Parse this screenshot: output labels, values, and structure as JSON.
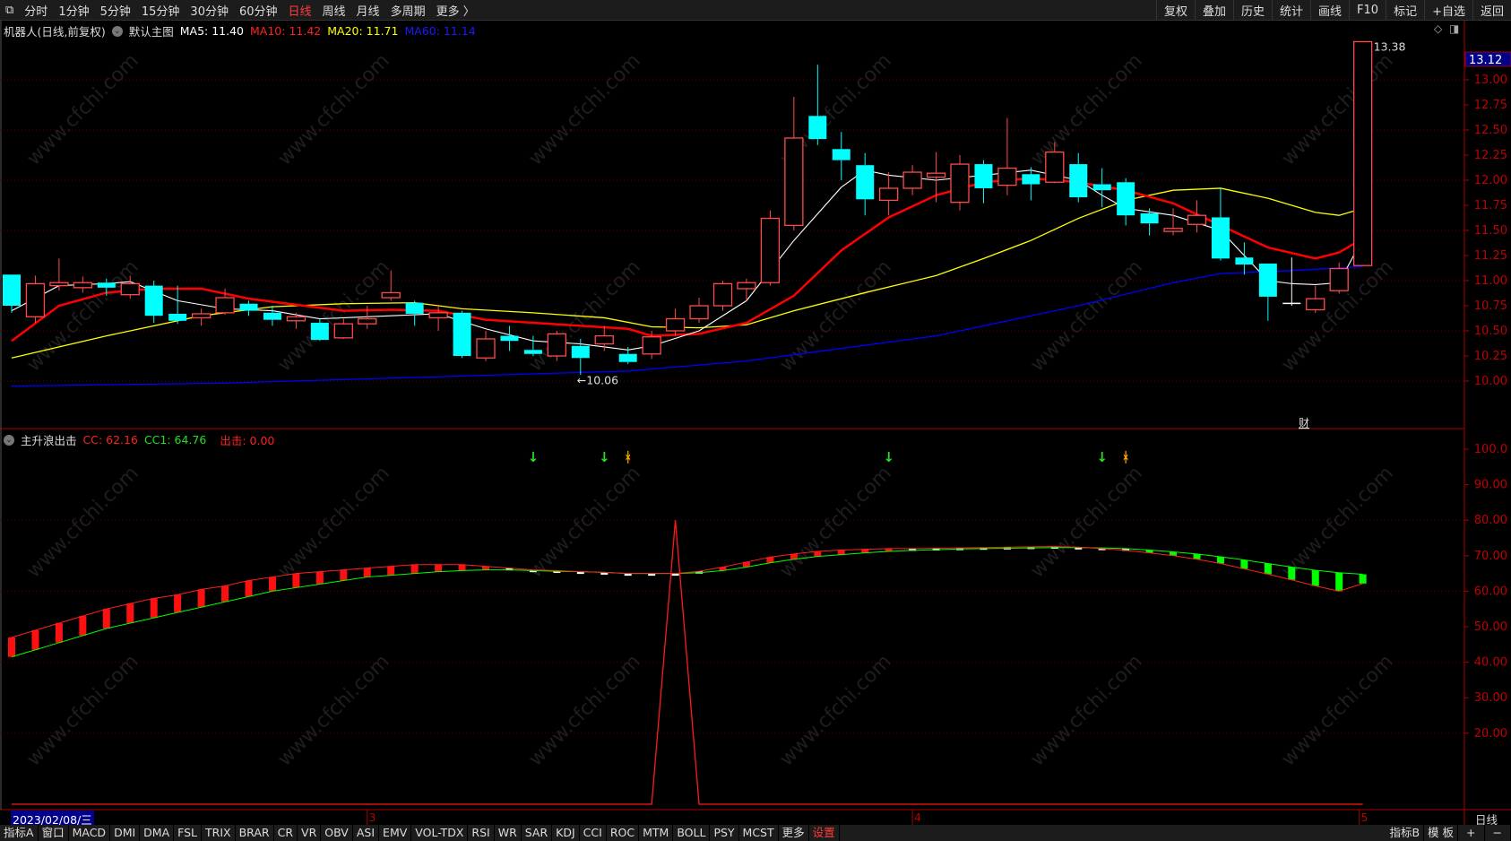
{
  "topbar": {
    "periods": [
      "分时",
      "1分钟",
      "5分钟",
      "15分钟",
      "30分钟",
      "60分钟",
      "日线",
      "周线",
      "月线",
      "多周期",
      "更多 〉"
    ],
    "active": "日线",
    "actions": [
      "复权",
      "叠加",
      "历史",
      "统计",
      "画线",
      "F10",
      "标记",
      "+自选",
      "返回"
    ]
  },
  "legend": {
    "title": "机器人(日线,前复权)",
    "main": "默认主图",
    "ma5": "MA5: 11.40",
    "ma10": "MA10: 11.42",
    "ma20": "MA20: 11.71",
    "ma60": "MA60: 11.14"
  },
  "indicator_legend": {
    "title": "主升浪出击",
    "cc": "CC: 62.16",
    "cc1": "CC1: 64.76",
    "chuji": "出击: 0.00"
  },
  "labels": {
    "high": "13.38",
    "low": "←10.06",
    "current_price": "13.12",
    "cai": "财",
    "date": "2023/02/08/三",
    "period": "日线",
    "watermark": "www.cfchi.com"
  },
  "colors": {
    "up": "#ff4a4a",
    "down": "#00ffff",
    "ma5": "#ffffff",
    "ma10": "#ff0000",
    "ma20": "#ffff00",
    "ma60": "#0000ff",
    "axis": "#aa0000"
  },
  "chart_data": {
    "type": "candlestick",
    "price_ticks": [
      "13.00",
      "12.75",
      "12.50",
      "12.25",
      "12.00",
      "11.75",
      "11.50",
      "11.25",
      "11.00",
      "10.75",
      "10.50",
      "10.25",
      "10.00"
    ],
    "ind_ticks": [
      "100.0",
      "90.00",
      "80.00",
      "70.00",
      "60.00",
      "50.00",
      "40.00",
      "30.00",
      "20.00"
    ],
    "month_labels": [
      {
        "i": 16,
        "t": "3"
      },
      {
        "i": 39,
        "t": "4"
      },
      {
        "i": 58,
        "t": "5"
      }
    ],
    "candles": [
      [
        11.06,
        10.75,
        11.06,
        10.68
      ],
      [
        10.64,
        10.97,
        11.05,
        10.58
      ],
      [
        10.95,
        10.98,
        11.22,
        10.9
      ],
      [
        10.93,
        10.98,
        11.04,
        10.88
      ],
      [
        10.98,
        10.93,
        11.02,
        10.85
      ],
      [
        10.86,
        10.97,
        11.05,
        10.82
      ],
      [
        10.95,
        10.65,
        11,
        10.58
      ],
      [
        10.67,
        10.6,
        10.95,
        10.57
      ],
      [
        10.63,
        10.67,
        10.72,
        10.55
      ],
      [
        10.68,
        10.83,
        10.92,
        10.66
      ],
      [
        10.77,
        10.7,
        10.8,
        10.65
      ],
      [
        10.68,
        10.61,
        10.75,
        10.55
      ],
      [
        10.6,
        10.64,
        10.68,
        10.52
      ],
      [
        10.58,
        10.41,
        10.62,
        10.4
      ],
      [
        10.43,
        10.57,
        10.62,
        10.42
      ],
      [
        10.57,
        10.62,
        10.75,
        10.52
      ],
      [
        10.83,
        10.88,
        11.1,
        10.8
      ],
      [
        10.78,
        10.67,
        10.8,
        10.55
      ],
      [
        10.63,
        10.68,
        10.75,
        10.5
      ],
      [
        10.68,
        10.25,
        10.7,
        10.23
      ],
      [
        10.23,
        10.42,
        10.5,
        10.2
      ],
      [
        10.45,
        10.4,
        10.55,
        10.3
      ],
      [
        10.31,
        10.27,
        10.45,
        10.25
      ],
      [
        10.25,
        10.47,
        10.5,
        10.2
      ],
      [
        10.35,
        10.23,
        10.42,
        10.06
      ],
      [
        10.37,
        10.45,
        10.55,
        10.3
      ],
      [
        10.27,
        10.19,
        10.34,
        10.17
      ],
      [
        10.27,
        10.44,
        10.5,
        10.22
      ],
      [
        10.5,
        10.62,
        10.72,
        10.45
      ],
      [
        10.62,
        10.75,
        10.83,
        10.58
      ],
      [
        10.75,
        10.97,
        11,
        10.7
      ],
      [
        10.92,
        10.98,
        11.02,
        10.8
      ],
      [
        10.98,
        11.62,
        11.7,
        10.95
      ],
      [
        11.55,
        12.42,
        12.83,
        11.5
      ],
      [
        12.64,
        12.41,
        13.15,
        12.35
      ],
      [
        12.31,
        12.2,
        12.48,
        12
      ],
      [
        12.15,
        11.81,
        12.27,
        11.65
      ],
      [
        11.8,
        11.92,
        12.08,
        11.65
      ],
      [
        11.92,
        12.08,
        12.15,
        11.85
      ],
      [
        12.03,
        12.07,
        12.28,
        11.78
      ],
      [
        11.78,
        12.16,
        12.25,
        11.7
      ],
      [
        12.16,
        11.92,
        12.2,
        11.77
      ],
      [
        11.95,
        12.12,
        12.62,
        11.85
      ],
      [
        12.06,
        11.96,
        12.13,
        11.8
      ],
      [
        11.98,
        12.28,
        12.38,
        11.97
      ],
      [
        12.16,
        11.83,
        12.27,
        11.78
      ],
      [
        11.96,
        11.9,
        12.12,
        11.73
      ],
      [
        11.98,
        11.65,
        12.02,
        11.55
      ],
      [
        11.67,
        11.57,
        11.72,
        11.45
      ],
      [
        11.49,
        11.52,
        11.72,
        11.45
      ],
      [
        11.56,
        11.65,
        11.8,
        11.48
      ],
      [
        11.63,
        11.22,
        11.92,
        11.2
      ],
      [
        11.23,
        11.16,
        11.38,
        11.06
      ],
      [
        11.17,
        10.84,
        11.17,
        10.6
      ],
      [
        10.78,
        10.78,
        11.23,
        10.75
      ],
      [
        10.71,
        10.82,
        10.95,
        10.68
      ],
      [
        10.9,
        11.12,
        11.18,
        10.87
      ],
      [
        11.15,
        13.38,
        13.38,
        11.15
      ]
    ],
    "ma5": [
      [
        1,
        10.7
      ],
      [
        3,
        10.95
      ],
      [
        5,
        10.97
      ],
      [
        6,
        10.99
      ],
      [
        8,
        10.8
      ],
      [
        10,
        10.72
      ],
      [
        12,
        10.7
      ],
      [
        14,
        10.62
      ],
      [
        16,
        10.64
      ],
      [
        18,
        10.66
      ],
      [
        19,
        10.67
      ],
      [
        21,
        10.52
      ],
      [
        23,
        10.4
      ],
      [
        25,
        10.37
      ],
      [
        27,
        10.31
      ],
      [
        28,
        10.35
      ],
      [
        30,
        10.5
      ],
      [
        32,
        10.8
      ],
      [
        34,
        11.4
      ],
      [
        36,
        11.93
      ],
      [
        37,
        12.1
      ],
      [
        38,
        12.05
      ],
      [
        40,
        12
      ],
      [
        42,
        12.05
      ],
      [
        44,
        12.1
      ],
      [
        46,
        12
      ],
      [
        47,
        11.85
      ],
      [
        48,
        11.72
      ],
      [
        50,
        11.65
      ],
      [
        52,
        11.5
      ],
      [
        54,
        11.0
      ],
      [
        55,
        10.97
      ],
      [
        56,
        10.96
      ],
      [
        57,
        10.98
      ],
      [
        58,
        11.42
      ]
    ],
    "ma10": [
      [
        1,
        10.4
      ],
      [
        3,
        10.75
      ],
      [
        5,
        10.88
      ],
      [
        7,
        10.92
      ],
      [
        9,
        10.92
      ],
      [
        11,
        10.82
      ],
      [
        13,
        10.76
      ],
      [
        15,
        10.7
      ],
      [
        17,
        10.71
      ],
      [
        19,
        10.7
      ],
      [
        21,
        10.61
      ],
      [
        23,
        10.58
      ],
      [
        25,
        10.55
      ],
      [
        27,
        10.52
      ],
      [
        28,
        10.45
      ],
      [
        30,
        10.47
      ],
      [
        32,
        10.58
      ],
      [
        34,
        10.85
      ],
      [
        36,
        11.3
      ],
      [
        38,
        11.63
      ],
      [
        40,
        11.85
      ],
      [
        42,
        11.98
      ],
      [
        44,
        12.02
      ],
      [
        46,
        11.98
      ],
      [
        48,
        11.9
      ],
      [
        50,
        11.77
      ],
      [
        52,
        11.55
      ],
      [
        54,
        11.33
      ],
      [
        56,
        11.22
      ],
      [
        57,
        11.28
      ],
      [
        58,
        11.42
      ]
    ],
    "ma20": [
      [
        1,
        10.23
      ],
      [
        5,
        10.45
      ],
      [
        9,
        10.65
      ],
      [
        12,
        10.74
      ],
      [
        15,
        10.77
      ],
      [
        18,
        10.78
      ],
      [
        20,
        10.72
      ],
      [
        23,
        10.68
      ],
      [
        26,
        10.63
      ],
      [
        28,
        10.54
      ],
      [
        30,
        10.53
      ],
      [
        32,
        10.56
      ],
      [
        34,
        10.7
      ],
      [
        37,
        10.88
      ],
      [
        40,
        11.05
      ],
      [
        42,
        11.22
      ],
      [
        44,
        11.4
      ],
      [
        46,
        11.62
      ],
      [
        48,
        11.8
      ],
      [
        50,
        11.9
      ],
      [
        52,
        11.92
      ],
      [
        54,
        11.82
      ],
      [
        56,
        11.68
      ],
      [
        57,
        11.65
      ],
      [
        58,
        11.72
      ]
    ],
    "ma60": [
      [
        1,
        9.95
      ],
      [
        10,
        9.98
      ],
      [
        20,
        10.05
      ],
      [
        27,
        10.1
      ],
      [
        32,
        10.2
      ],
      [
        40,
        10.45
      ],
      [
        46,
        10.75
      ],
      [
        50,
        10.98
      ],
      [
        52,
        11.07
      ],
      [
        55,
        11.1
      ],
      [
        58,
        11.14
      ]
    ],
    "cc": [
      47,
      49,
      51,
      53,
      55,
      56.5,
      58,
      59,
      60.5,
      61.5,
      63,
      64,
      65,
      65.5,
      66,
      66.5,
      67,
      67.5,
      67.5,
      67.5,
      67,
      66.5,
      66,
      65.8,
      65.5,
      65.3,
      65,
      65,
      65,
      65.6,
      66.8,
      68.2,
      69.6,
      70.5,
      71.2,
      71.6,
      71.8,
      72,
      72,
      72.1,
      72.2,
      72.3,
      72.4,
      72.5,
      72.6,
      72.4,
      72,
      71.5,
      70.8,
      70,
      69,
      67.8,
      66.3,
      64.8,
      63.2,
      61.5,
      60,
      62.16
    ],
    "cc1": [
      41.5,
      43.5,
      45.5,
      47.5,
      49.5,
      51,
      52.5,
      54,
      55.5,
      57,
      58.5,
      60,
      61,
      62,
      63,
      64,
      64.5,
      65,
      65.5,
      65.8,
      66,
      66,
      65.8,
      65.6,
      65.5,
      65.3,
      65,
      65,
      65,
      65.2,
      65.8,
      66.8,
      68,
      69,
      69.8,
      70.3,
      70.8,
      71.2,
      71.5,
      71.7,
      71.9,
      72,
      72.1,
      72.2,
      72.3,
      72.3,
      72.2,
      72,
      71.6,
      71.1,
      70.5,
      69.7,
      68.8,
      67.8,
      66.8,
      65.9,
      65.2,
      64.76
    ],
    "chuji": {
      "spike_index": 29,
      "spike_value": 80,
      "base": 0
    },
    "signals": [
      {
        "i": 23,
        "type": "down-arrow"
      },
      {
        "i": 26,
        "type": "down-arrow"
      },
      {
        "i": 27,
        "type": "figure"
      },
      {
        "i": 38,
        "type": "down-arrow"
      },
      {
        "i": 47,
        "type": "down-arrow"
      },
      {
        "i": 48,
        "type": "figure"
      }
    ]
  }
}
